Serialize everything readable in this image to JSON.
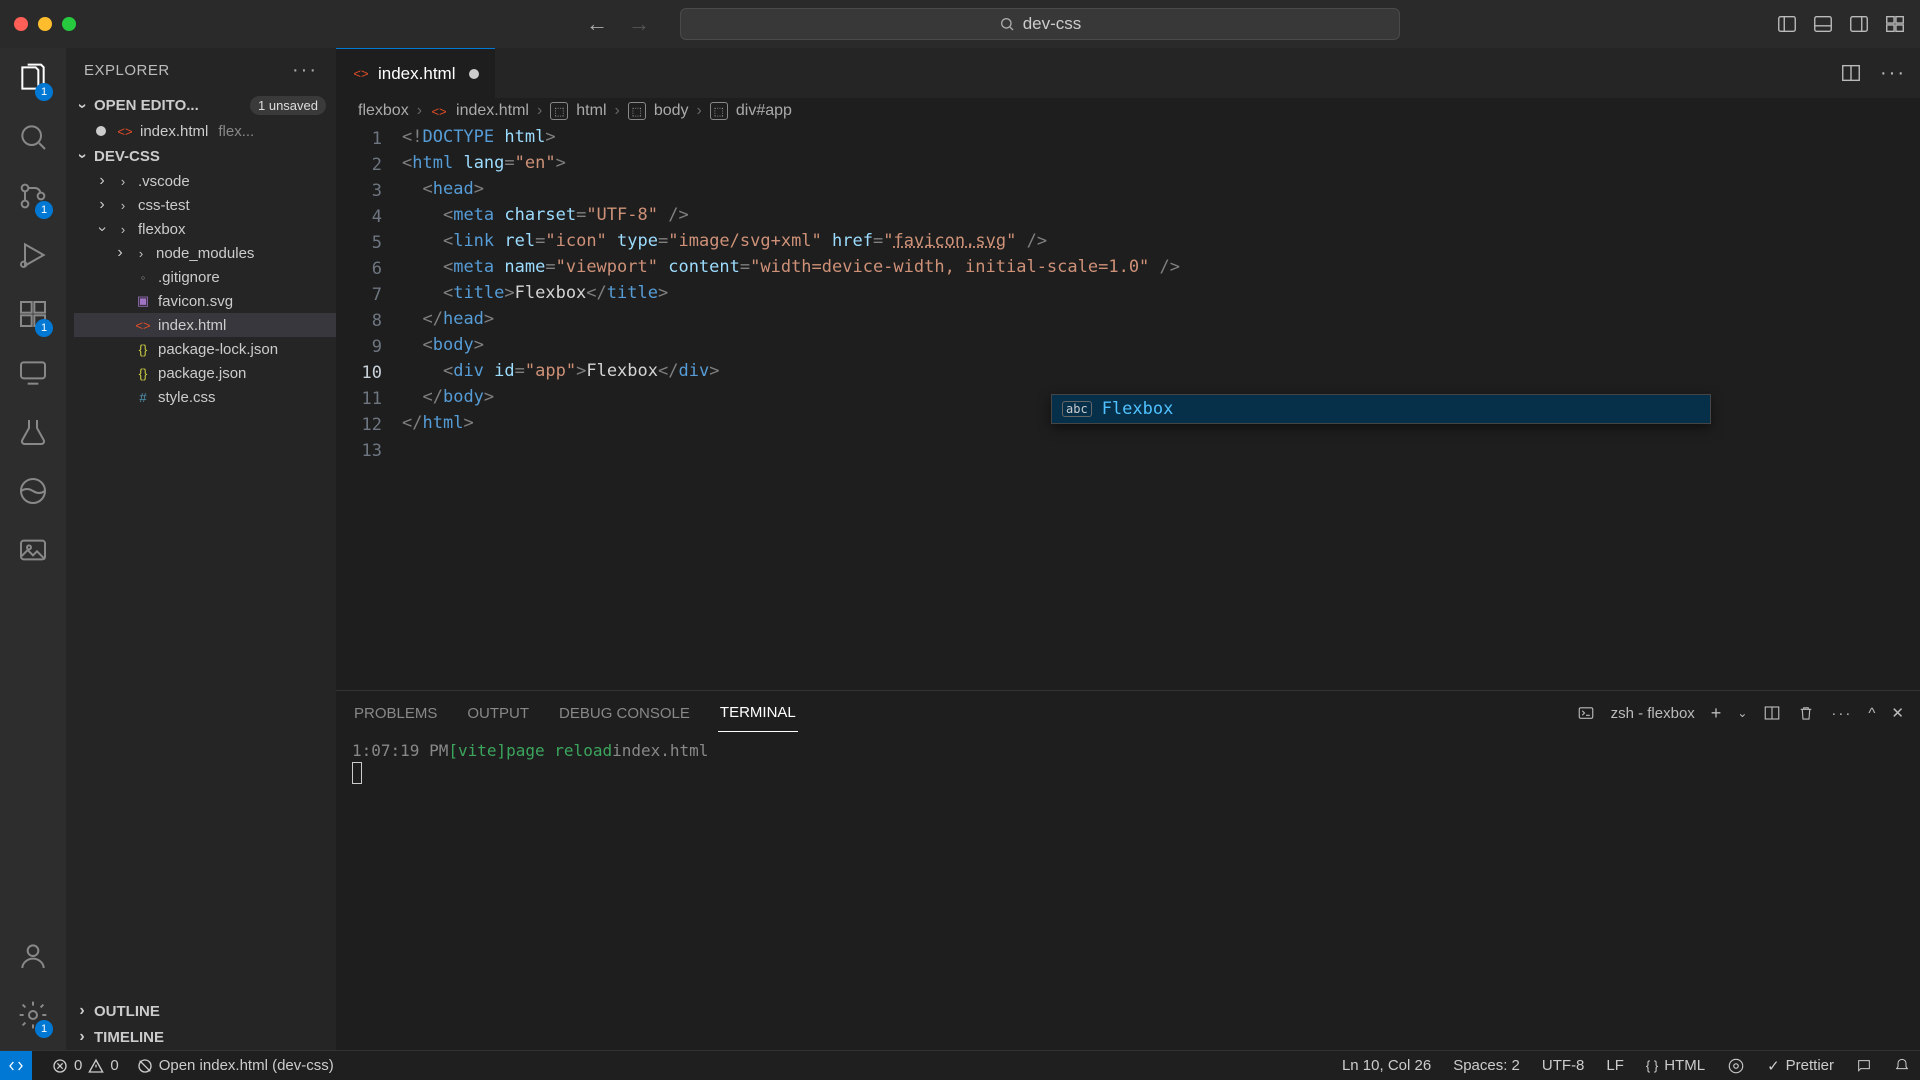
{
  "title": "dev-css",
  "sidebar": {
    "title": "EXPLORER",
    "open_editors_label": "OPEN EDITO...",
    "unsaved_badge": "1 unsaved",
    "open_editor_file": "index.html",
    "open_editor_hint": "flex...",
    "workspace": "DEV-CSS",
    "tree": [
      {
        "name": ".vscode",
        "kind": "folder",
        "indent": 1
      },
      {
        "name": "css-test",
        "kind": "folder",
        "indent": 1
      },
      {
        "name": "flexbox",
        "kind": "folder",
        "indent": 1,
        "expanded": true
      },
      {
        "name": "node_modules",
        "kind": "folder",
        "indent": 2
      },
      {
        "name": ".gitignore",
        "kind": "git",
        "indent": 2
      },
      {
        "name": "favicon.svg",
        "kind": "svg",
        "indent": 2
      },
      {
        "name": "index.html",
        "kind": "html",
        "indent": 2,
        "selected": true
      },
      {
        "name": "package-lock.json",
        "kind": "json",
        "indent": 2
      },
      {
        "name": "package.json",
        "kind": "json",
        "indent": 2
      },
      {
        "name": "style.css",
        "kind": "css",
        "indent": 2
      }
    ],
    "outline": "OUTLINE",
    "timeline": "TIMELINE"
  },
  "tab": {
    "label": "index.html"
  },
  "breadcrumbs": [
    "flexbox",
    "index.html",
    "html",
    "body",
    "div#app"
  ],
  "editor": {
    "line_count": 13,
    "current_line": 10
  },
  "autocomplete": {
    "kind": "abc",
    "text": "Flexbox"
  },
  "panel": {
    "tabs": [
      "PROBLEMS",
      "OUTPUT",
      "DEBUG CONSOLE",
      "TERMINAL"
    ],
    "active": "TERMINAL",
    "terminal_label": "zsh - flexbox",
    "term_time": "1:07:19 PM ",
    "term_vite": "[vite]",
    "term_msg": " page reload ",
    "term_file": "index.html"
  },
  "statusbar": {
    "errors": "0",
    "warnings": "0",
    "open_file": "Open index.html (dev-css)",
    "position": "Ln 10, Col 26",
    "spaces": "Spaces: 2",
    "encoding": "UTF-8",
    "eol": "LF",
    "lang": "HTML",
    "prettier": "Prettier"
  },
  "badges": {
    "explorer": "1",
    "scm": "1",
    "ext": "1",
    "settings": "1"
  }
}
